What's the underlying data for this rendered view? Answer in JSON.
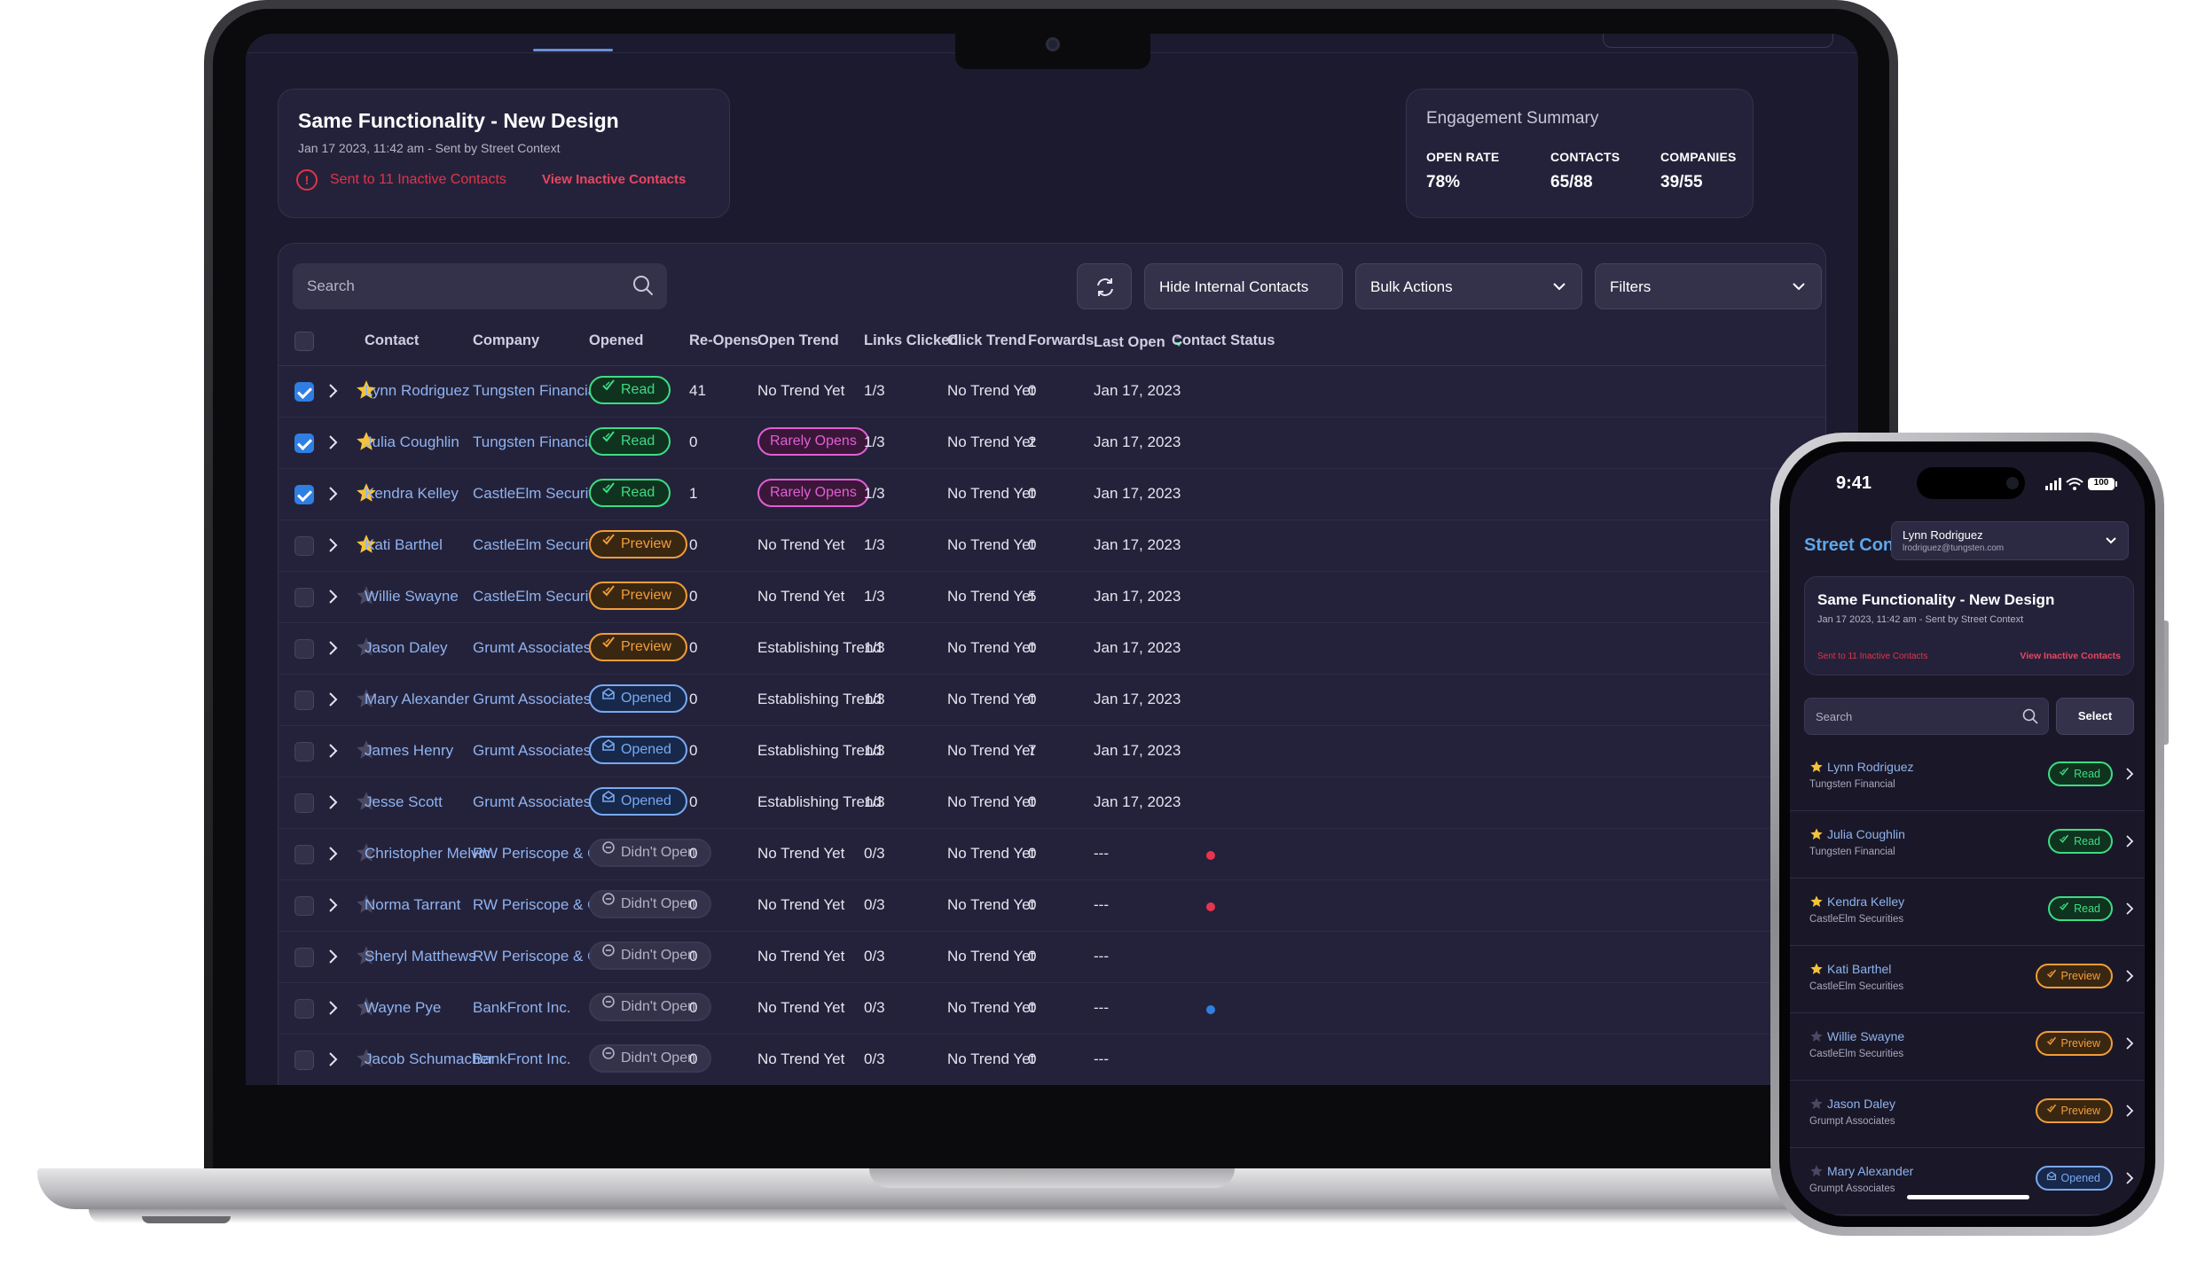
{
  "campaign": {
    "title": "Same Functionality - New Design",
    "subtitle": "Jan 17 2023, 11:42 am - Sent by Street Context",
    "warning": "Sent to 11 Inactive Contacts",
    "warning_link": "View Inactive Contacts"
  },
  "summary": {
    "title": "Engagement Summary",
    "open_rate_label": "OPEN RATE",
    "open_rate": "78%",
    "contacts_label": "CONTACTS",
    "contacts": "65/88",
    "companies_label": "COMPANIES",
    "companies": "39/55"
  },
  "toolbar": {
    "search_placeholder": "Search",
    "hide_internal": "Hide Internal Contacts",
    "bulk_actions": "Bulk Actions",
    "filters": "Filters"
  },
  "table": {
    "headers": {
      "contact": "Contact",
      "company": "Company",
      "opened": "Opened",
      "reopens": "Re-Opens",
      "open_trend": "Open Trend",
      "links_clicked": "Links Clicked",
      "click_trend": "Click Trend",
      "forwards": "Forwards",
      "last_open": "Last Open",
      "contact_status": "Contact Status"
    },
    "rows": [
      {
        "checked": true,
        "starred": true,
        "contact": "Lynn Rodriguez",
        "company": "Tungsten Financial",
        "opened": "Read",
        "opened_type": "read",
        "reopens": "41",
        "open_trend": "No Trend Yet",
        "open_trend_badge": false,
        "links": "1/3",
        "click_trend": "No Trend Yet",
        "forwards": "0",
        "last_open": "Jan 17, 2023",
        "status_color": ""
      },
      {
        "checked": true,
        "starred": true,
        "contact": "Julia Coughlin",
        "company": "Tungsten Financial",
        "opened": "Read",
        "opened_type": "read",
        "reopens": "0",
        "open_trend": "Rarely Opens",
        "open_trend_badge": true,
        "links": "1/3",
        "click_trend": "No Trend Yet",
        "forwards": "2",
        "last_open": "Jan 17, 2023",
        "status_color": ""
      },
      {
        "checked": true,
        "starred": true,
        "contact": "Kendra Kelley",
        "company": "CastleElm Securities",
        "opened": "Read",
        "opened_type": "read",
        "reopens": "1",
        "open_trend": "Rarely Opens",
        "open_trend_badge": true,
        "links": "1/3",
        "click_trend": "No Trend Yet",
        "forwards": "0",
        "last_open": "Jan 17, 2023",
        "status_color": ""
      },
      {
        "checked": false,
        "starred": true,
        "contact": "Kati Barthel",
        "company": "CastleElm Securities",
        "opened": "Preview",
        "opened_type": "preview",
        "reopens": "0",
        "open_trend": "No Trend Yet",
        "open_trend_badge": false,
        "links": "1/3",
        "click_trend": "No Trend Yet",
        "forwards": "0",
        "last_open": "Jan 17, 2023",
        "status_color": ""
      },
      {
        "checked": false,
        "starred": false,
        "contact": "Willie Swayne",
        "company": "CastleElm Securities",
        "opened": "Preview",
        "opened_type": "preview",
        "reopens": "0",
        "open_trend": "No Trend Yet",
        "open_trend_badge": false,
        "links": "1/3",
        "click_trend": "No Trend Yet",
        "forwards": "5",
        "last_open": "Jan 17, 2023",
        "status_color": ""
      },
      {
        "checked": false,
        "starred": false,
        "contact": "Jason Daley",
        "company": "Grumt Associates",
        "opened": "Preview",
        "opened_type": "preview",
        "reopens": "0",
        "open_trend": "Establishing Trend",
        "open_trend_badge": false,
        "links": "1/3",
        "click_trend": "No Trend Yet",
        "forwards": "0",
        "last_open": "Jan 17, 2023",
        "status_color": ""
      },
      {
        "checked": false,
        "starred": false,
        "contact": "Mary Alexander",
        "company": "Grumt Associates",
        "opened": "Opened",
        "opened_type": "opened",
        "reopens": "0",
        "open_trend": "Establishing Trend",
        "open_trend_badge": false,
        "links": "1/3",
        "click_trend": "No Trend Yet",
        "forwards": "0",
        "last_open": "Jan 17, 2023",
        "status_color": ""
      },
      {
        "checked": false,
        "starred": false,
        "contact": "James Henry",
        "company": "Grumt Associates",
        "opened": "Opened",
        "opened_type": "opened",
        "reopens": "0",
        "open_trend": "Establishing Trend",
        "open_trend_badge": false,
        "links": "1/3",
        "click_trend": "No Trend Yet",
        "forwards": "7",
        "last_open": "Jan 17, 2023",
        "status_color": ""
      },
      {
        "checked": false,
        "starred": false,
        "contact": "Jesse Scott",
        "company": "Grumt Associates",
        "opened": "Opened",
        "opened_type": "opened",
        "reopens": "0",
        "open_trend": "Establishing Trend",
        "open_trend_badge": false,
        "links": "1/3",
        "click_trend": "No Trend Yet",
        "forwards": "0",
        "last_open": "Jan 17, 2023",
        "status_color": ""
      },
      {
        "checked": false,
        "starred": false,
        "contact": "Christopher Melvin",
        "company": "RW Periscope & Co.",
        "opened": "Didn't Open",
        "opened_type": "didnt",
        "reopens": "0",
        "open_trend": "No Trend Yet",
        "open_trend_badge": false,
        "links": "0/3",
        "click_trend": "No Trend Yet",
        "forwards": "0",
        "last_open": "---",
        "status_color": "#e8344e"
      },
      {
        "checked": false,
        "starred": false,
        "contact": "Norma Tarrant",
        "company": "RW Periscope & Co.",
        "opened": "Didn't Open",
        "opened_type": "didnt",
        "reopens": "0",
        "open_trend": "No Trend Yet",
        "open_trend_badge": false,
        "links": "0/3",
        "click_trend": "No Trend Yet",
        "forwards": "0",
        "last_open": "---",
        "status_color": "#e8344e"
      },
      {
        "checked": false,
        "starred": false,
        "contact": "Sheryl Matthews",
        "company": "RW Periscope & Co.",
        "opened": "Didn't Open",
        "opened_type": "didnt",
        "reopens": "0",
        "open_trend": "No Trend Yet",
        "open_trend_badge": false,
        "links": "0/3",
        "click_trend": "No Trend Yet",
        "forwards": "0",
        "last_open": "---",
        "status_color": ""
      },
      {
        "checked": false,
        "starred": false,
        "contact": "Wayne Pye",
        "company": "BankFront Inc.",
        "opened": "Didn't Open",
        "opened_type": "didnt",
        "reopens": "0",
        "open_trend": "No Trend Yet",
        "open_trend_badge": false,
        "links": "0/3",
        "click_trend": "No Trend Yet",
        "forwards": "0",
        "last_open": "---",
        "status_color": "#2f7fe3"
      },
      {
        "checked": false,
        "starred": false,
        "contact": "Jacob Schumacher",
        "company": "BankFront Inc.",
        "opened": "Didn't Open",
        "opened_type": "didnt",
        "reopens": "0",
        "open_trend": "No Trend Yet",
        "open_trend_badge": false,
        "links": "0/3",
        "click_trend": "No Trend Yet",
        "forwards": "0",
        "last_open": "---",
        "status_color": ""
      }
    ]
  },
  "phone": {
    "time": "9:41",
    "battery": "100",
    "brand": "Street Context",
    "user_name": "Lynn Rodriguez",
    "user_email": "lrodriguez@tungsten.com",
    "search_placeholder": "Search",
    "select_label": "Select",
    "rows": [
      {
        "starred": true,
        "name": "Lynn Rodriguez",
        "company": "Tungsten Financial",
        "badge": "Read",
        "badge_type": "read"
      },
      {
        "starred": true,
        "name": "Julia Coughlin",
        "company": "Tungsten Financial",
        "badge": "Read",
        "badge_type": "read"
      },
      {
        "starred": true,
        "name": "Kendra Kelley",
        "company": "CastleElm Securities",
        "badge": "Read",
        "badge_type": "read"
      },
      {
        "starred": true,
        "name": "Kati Barthel",
        "company": "CastleElm Securities",
        "badge": "Preview",
        "badge_type": "preview"
      },
      {
        "starred": false,
        "name": "Willie Swayne",
        "company": "CastleElm Securities",
        "badge": "Preview",
        "badge_type": "preview"
      },
      {
        "starred": false,
        "name": "Jason Daley",
        "company": "Grumpt Associates",
        "badge": "Preview",
        "badge_type": "preview"
      },
      {
        "starred": false,
        "name": "Mary Alexander",
        "company": "Grumpt Associates",
        "badge": "Opened",
        "badge_type": "opened"
      }
    ]
  },
  "colors": {
    "read": "#3ddc84",
    "preview": "#f29d38",
    "opened": "#79a9f2",
    "rarely_opens": "#e05fd4",
    "alert": "#e0344b",
    "checkbox_on": "#2f7fe3",
    "star": "#f5c33b"
  },
  "icons": {
    "search": "search-icon",
    "refresh": "refresh-icon",
    "chevron": "chevron-down-icon",
    "expand": "chevron-right-icon",
    "star": "star-icon",
    "warning": "alert-circle-icon"
  }
}
